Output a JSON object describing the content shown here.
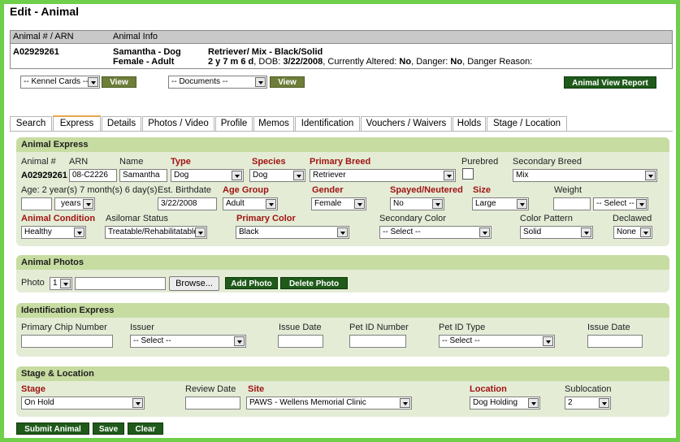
{
  "page": {
    "title": "Edit - Animal"
  },
  "info": {
    "header_col1": "Animal # / ARN",
    "header_col2": "Animal Info",
    "animal_id": "A02929261",
    "name_species": "Samantha - Dog",
    "sex_age": "Female - Adult",
    "breed_desc": "Retriever/ Mix - Black/Solid",
    "age_line_bold": "2 y 7 m 6 d",
    "age_line_rest": ", DOB: ",
    "dob": "3/22/2008",
    "altered_label": ", Currently Altered: ",
    "altered": "No",
    "danger_label": ", Danger: ",
    "danger": "No",
    "danger_reason_label": ", Danger Reason:"
  },
  "toolbar": {
    "kennel_select": "-- Kennel Cards --",
    "view1": "View",
    "documents_select": "-- Documents --",
    "view2": "View",
    "report_button": "Animal View Report"
  },
  "tabs": [
    "Search",
    "Express",
    "Details",
    "Photos / Video",
    "Profile",
    "Memos",
    "Identification",
    "Vouchers / Waivers",
    "Holds",
    "Stage / Location"
  ],
  "active_tab": "Express",
  "express": {
    "heading": "Animal Express",
    "labels": {
      "animal_no": "Animal #",
      "arn": "ARN",
      "name": "Name",
      "type": "Type",
      "species": "Species",
      "primary_breed": "Primary Breed",
      "purebred": "Purebred",
      "secondary_breed": "Secondary Breed",
      "age": "Age: 2 year(s) 7 month(s) 6 day(s)",
      "est_birthdate": "Est. Birthdate",
      "age_group": "Age Group",
      "gender": "Gender",
      "spayed": "Spayed/Neutered",
      "size": "Size",
      "weight": "Weight",
      "condition": "Animal Condition",
      "asilomar": "Asilomar Status",
      "primary_color": "Primary Color",
      "secondary_color": "Secondary Color",
      "color_pattern": "Color Pattern",
      "declawed": "Declawed"
    },
    "values": {
      "animal_no": "A02929261",
      "arn": "08-C2226",
      "name": "Samantha",
      "type": "Dog",
      "species": "Dog",
      "primary_breed": "Retriever",
      "secondary_breed": "Mix",
      "age_value": "",
      "age_unit": "years",
      "est_birthdate": "3/22/2008",
      "age_group": "Adult",
      "gender": "Female",
      "spayed": "No",
      "size": "Large",
      "weight": "",
      "weight_unit": "-- Select --",
      "condition": "Healthy",
      "asilomar": "Treatable/Rehabilitatable",
      "primary_color": "Black",
      "secondary_color": "-- Select --",
      "color_pattern": "Solid",
      "declawed": "None"
    }
  },
  "photos": {
    "heading": "Animal Photos",
    "label": "Photo",
    "photo_no": "1",
    "browse": "Browse...",
    "add": "Add Photo",
    "delete": "Delete Photo"
  },
  "identification": {
    "heading": "Identification Express",
    "labels": {
      "chip": "Primary Chip Number",
      "issuer": "Issuer",
      "issue_date": "Issue Date",
      "pet_id": "Pet ID Number",
      "pet_id_type": "Pet ID Type",
      "issue_date2": "Issue Date"
    },
    "values": {
      "issuer": "-- Select --",
      "pet_id_type": "-- Select --"
    }
  },
  "stage": {
    "heading": "Stage & Location",
    "labels": {
      "stage": "Stage",
      "review": "Review Date",
      "site": "Site",
      "location": "Location",
      "sublocation": "Sublocation"
    },
    "values": {
      "stage": "On Hold",
      "site": "PAWS - Wellens Memorial Clinic",
      "location": "Dog Holding",
      "sublocation": "2"
    }
  },
  "actions": {
    "submit": "Submit Animal",
    "save": "Save",
    "clear": "Clear"
  }
}
